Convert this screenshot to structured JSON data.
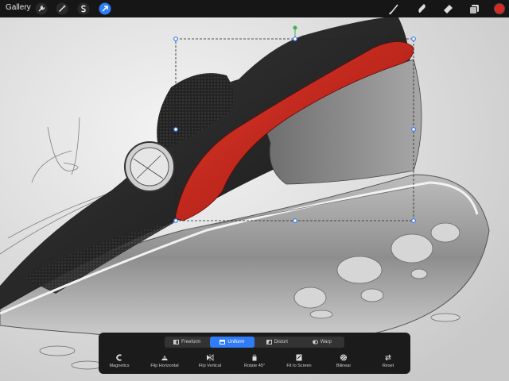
{
  "topbar": {
    "gallery_label": "Gallery",
    "tools_left": [
      "wrench-icon",
      "adjustments-wand-icon",
      "selection-s-icon",
      "transform-arrow-icon"
    ],
    "tools_right": [
      "brush-icon",
      "smudge-icon",
      "eraser-icon",
      "layers-icon",
      "color-swatch"
    ],
    "active_tool": "transform-arrow-icon",
    "active_color": "#d42a22"
  },
  "panel": {
    "modes": [
      {
        "label": "Freeform",
        "icon": "freeform-icon",
        "active": false
      },
      {
        "label": "Uniform",
        "icon": "uniform-icon",
        "active": true
      },
      {
        "label": "Distort",
        "icon": "distort-icon",
        "active": false
      },
      {
        "label": "Warp",
        "icon": "warp-icon",
        "active": false
      }
    ],
    "actions": [
      {
        "label": "Magnetics",
        "icon": "magnet-icon"
      },
      {
        "label": "Flip Horizontal",
        "icon": "flip-horizontal-icon"
      },
      {
        "label": "Flip Vertical",
        "icon": "flip-vertical-icon"
      },
      {
        "label": "Rotate 45°",
        "icon": "rotate-icon"
      },
      {
        "label": "Fit to Screen",
        "icon": "fit-screen-icon"
      },
      {
        "label": "Bilinear",
        "icon": "bilinear-icon"
      },
      {
        "label": "Reset",
        "icon": "reset-icon"
      }
    ]
  },
  "colors": {
    "accent": "#2f7cf6",
    "toolbar_bg": "#161616",
    "shoe_red": "#c92218"
  }
}
